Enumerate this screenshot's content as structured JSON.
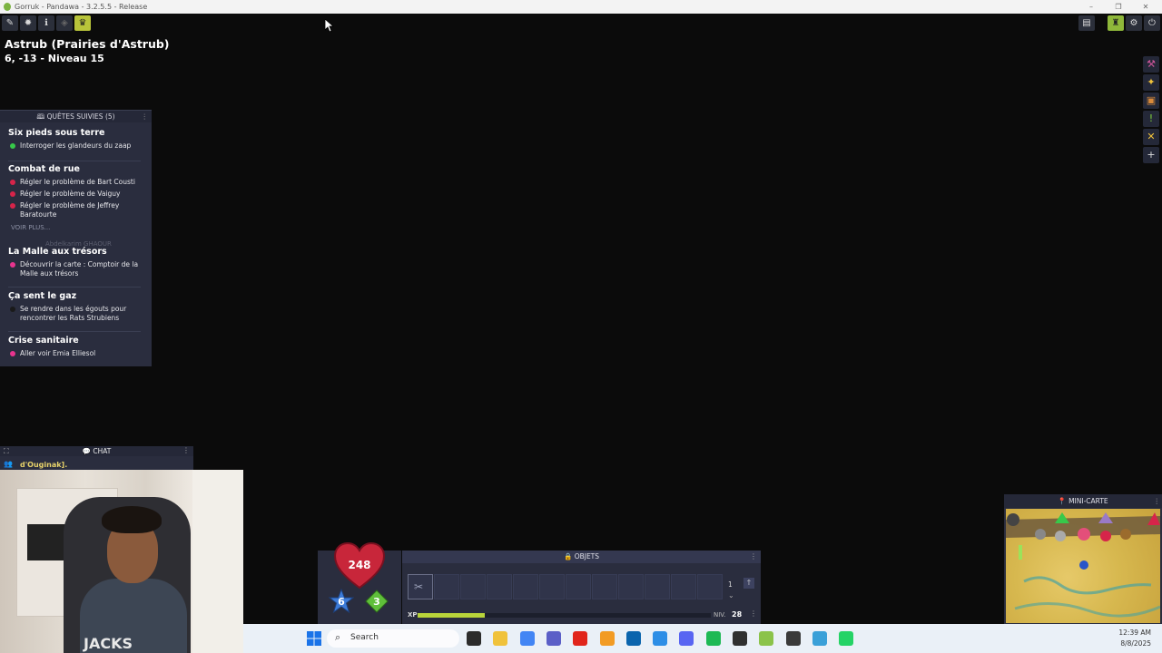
{
  "window": {
    "title": "Gorruk - Pandawa - 3.2.5.5 - Release",
    "controls": [
      "–",
      "❐",
      "✕"
    ]
  },
  "toolbar_left": {
    "icons": [
      "pencil-icon",
      "gear-sun-icon",
      "info-icon",
      "eye-icon",
      "crown-icon"
    ]
  },
  "map": {
    "title": "Astrub (Prairies d'Astrub)",
    "coords": "6, -13 - Niveau 15"
  },
  "quests": {
    "header": "QUÊTES SUIVIES (5)",
    "items": [
      {
        "title": "Six pieds sous terre",
        "objectives": [
          {
            "text": "Interroger les glandeurs du zaap",
            "color": "#37c94a"
          }
        ]
      },
      {
        "title": "Combat de rue",
        "objectives": [
          {
            "text": "Régler le problème de Bart Cousti",
            "color": "#d6244a"
          },
          {
            "text": "Régler le problème de Vaiguy",
            "color": "#d6244a"
          },
          {
            "text": "Régler le problème de Jeffrey Baratourte",
            "color": "#d6244a"
          }
        ]
      },
      {
        "title": "La Malle aux trésors",
        "objectives": [
          {
            "text": "Découvrir la carte : Comptoir de la Malle aux trésors",
            "color": "#e8348e"
          }
        ]
      },
      {
        "title": "Ça sent le gaz",
        "objectives": [
          {
            "text": "Se rendre dans les égouts pour rencontrer les Rats Strubiens",
            "color": "#1a1a1a"
          }
        ]
      },
      {
        "title": "Crise sanitaire",
        "objectives": [
          {
            "text": "Aller voir Emia Elliesol",
            "color": "#e8348e"
          }
        ]
      }
    ],
    "voir_plus": "VOIR PLUS...",
    "ghost_user": "Abdelkarim GHAOUR"
  },
  "chat": {
    "header": "CHAT",
    "line": "d'Ouginak]."
  },
  "webcam": {
    "shirt_text": "JACKS"
  },
  "hud": {
    "hp": "248",
    "ap": "6",
    "mp": "3"
  },
  "objets": {
    "header": "OBJETS",
    "page": "1",
    "xp_label": "XP",
    "xp_fraction": 0.23,
    "niv_label": "NIV.",
    "niv_value": "28",
    "slot_count": 12
  },
  "minimap": {
    "header": "MINI-CARTE"
  },
  "right_sidebar": {
    "icons": [
      "tools-icon",
      "star-wand-icon",
      "bag-icon",
      "exclamation-icon",
      "cross-swords-icon",
      "plus-icon"
    ]
  },
  "top_right": {
    "icons": [
      "layout-icon",
      "character-icon",
      "settings-icon",
      "power-icon"
    ]
  },
  "taskbar": {
    "search_label": "Search",
    "time": "12:39 AM",
    "date": "8/8/2025",
    "apps": [
      {
        "name": "task-view",
        "color": "#2b2b2b"
      },
      {
        "name": "file-explorer",
        "color": "#f0c23b"
      },
      {
        "name": "chrome",
        "color": "#4285f4"
      },
      {
        "name": "teams",
        "color": "#5b5fc7"
      },
      {
        "name": "acrobat",
        "color": "#e1251b"
      },
      {
        "name": "sublime",
        "color": "#f29b24"
      },
      {
        "name": "outlook",
        "color": "#0a64ad"
      },
      {
        "name": "vscode",
        "color": "#2d8ee6"
      },
      {
        "name": "discord",
        "color": "#5865f2"
      },
      {
        "name": "spotify",
        "color": "#1db954"
      },
      {
        "name": "obs",
        "color": "#303030"
      },
      {
        "name": "ankama",
        "color": "#8bc34a"
      },
      {
        "name": "record",
        "color": "#3a3a3a"
      },
      {
        "name": "notepad",
        "color": "#3aa0d8"
      },
      {
        "name": "whatsapp",
        "color": "#25d366"
      }
    ]
  }
}
